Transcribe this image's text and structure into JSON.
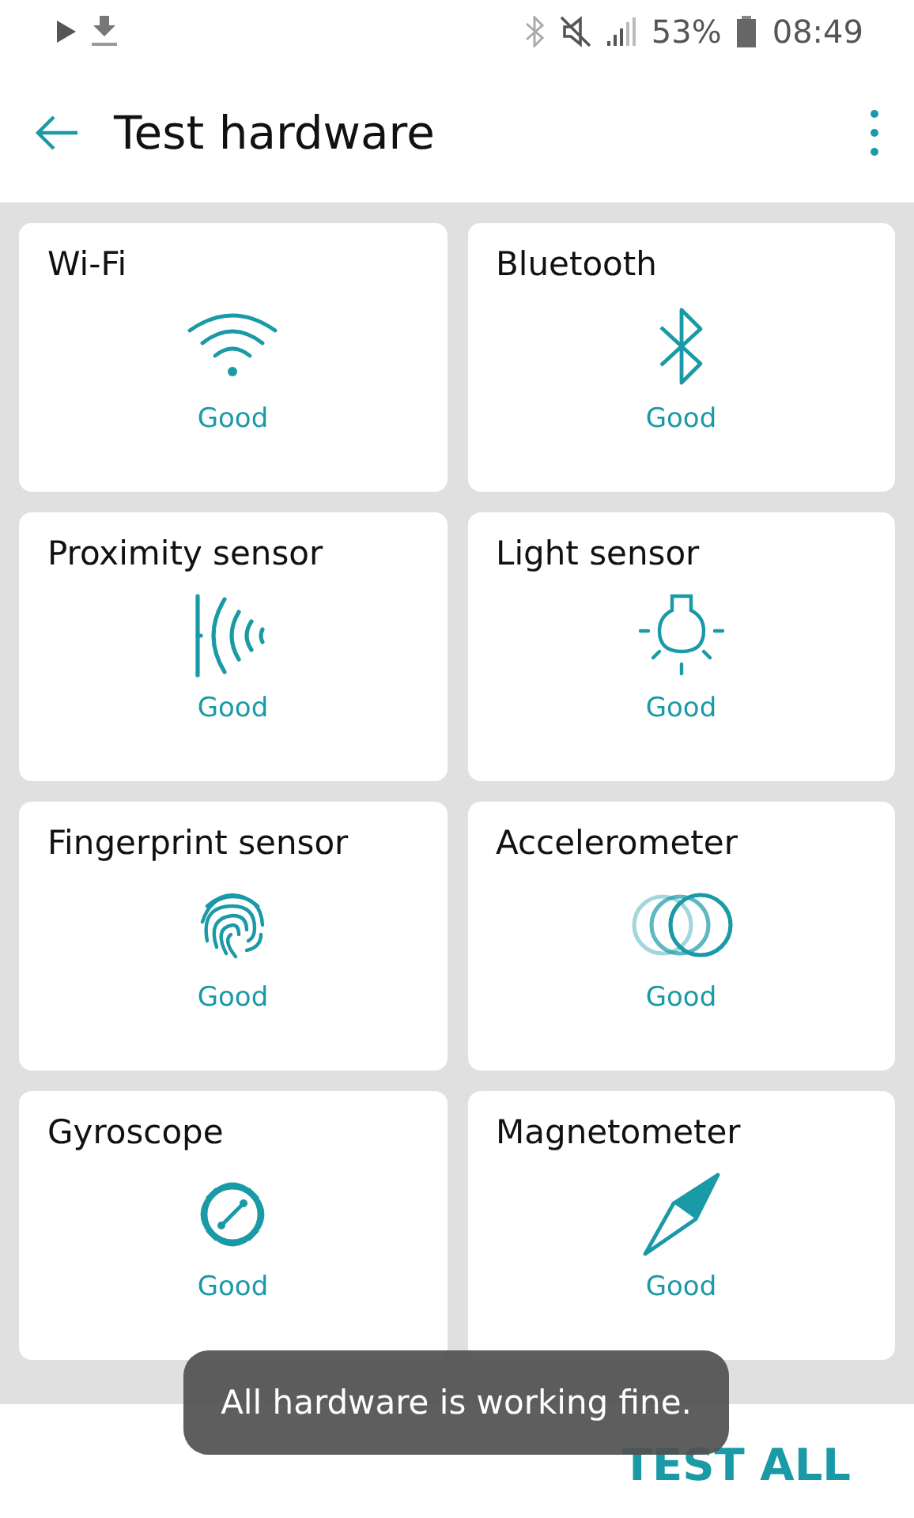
{
  "status_bar": {
    "battery": "53%",
    "time": "08:49"
  },
  "app_bar": {
    "title": "Test hardware"
  },
  "tests": [
    {
      "kind": "wifi",
      "name": "Wi-Fi",
      "result": "Good"
    },
    {
      "kind": "bluetooth",
      "name": "Bluetooth",
      "result": "Good"
    },
    {
      "kind": "proximity",
      "name": "Proximity sensor",
      "result": "Good"
    },
    {
      "kind": "light",
      "name": "Light sensor",
      "result": "Good"
    },
    {
      "kind": "fingerprint",
      "name": "Fingerprint sensor",
      "result": "Good"
    },
    {
      "kind": "accelerometer",
      "name": "Accelerometer",
      "result": "Good"
    },
    {
      "kind": "gyroscope",
      "name": "Gyroscope",
      "result": "Good"
    },
    {
      "kind": "magnetometer",
      "name": "Magnetometer",
      "result": "Good"
    }
  ],
  "toast": "All hardware is working fine.",
  "action": "TEST ALL"
}
